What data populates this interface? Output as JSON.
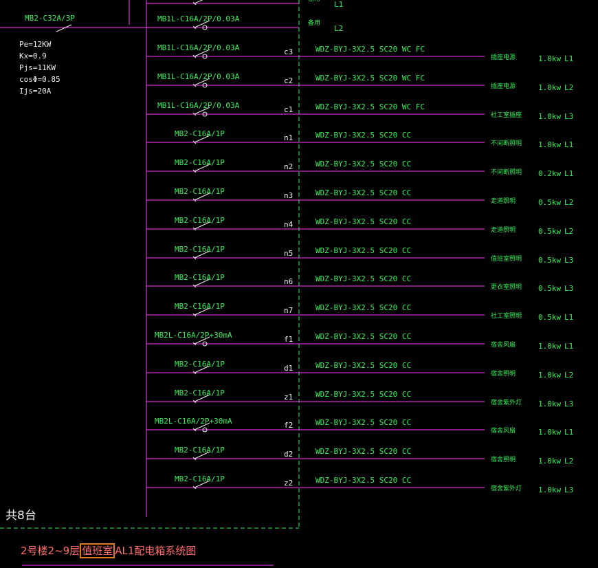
{
  "colors": {
    "bus": "#ff3cff",
    "wire": "#ff3cff",
    "text_green": "#34f05a",
    "text_white": "#f0f0f0",
    "title": "#ff6a6a",
    "highlight": "#e07a1a",
    "boundary": "#34f05a"
  },
  "main_breaker": {
    "label": "MB2-C32A/3P"
  },
  "parameters": [
    "Pe=12KW",
    "Kx=0.9",
    "Pjs=11KW",
    "cosΦ=0.85",
    "Ijs=20A"
  ],
  "corner_label": "共8台",
  "title": {
    "prefix": "2号楼2~9层",
    "highlight": "值班室",
    "suffix": "AL1配电箱系统图"
  },
  "circuits": [
    {
      "breaker": "",
      "code": "",
      "cable": "",
      "use": "备用",
      "power": "",
      "phase": "L1",
      "device": "switch"
    },
    {
      "breaker": "MB1L-C16A/2P/0.03A",
      "code": "",
      "cable": "",
      "use": "备用",
      "power": "",
      "phase": "L2",
      "device": "rcd"
    },
    {
      "breaker": "MB1L-C16A/2P/0.03A",
      "code": "c3",
      "cable": "WDZ-BYJ-3X2.5 SC20 WC FC",
      "use": "插座电源",
      "power": "1.0kw",
      "phase": "L1",
      "device": "rcd"
    },
    {
      "breaker": "MB1L-C16A/2P/0.03A",
      "code": "c2",
      "cable": "WDZ-BYJ-3X2.5 SC20 WC FC",
      "use": "插座电源",
      "power": "1.0kw",
      "phase": "L2",
      "device": "rcd"
    },
    {
      "breaker": "MB1L-C16A/2P/0.03A",
      "code": "c1",
      "cable": "WDZ-BYJ-3X2.5 SC20 WC FC",
      "use": "社工室插座",
      "power": "1.0kw",
      "phase": "L3",
      "device": "rcd"
    },
    {
      "breaker": "MB2-C16A/1P",
      "code": "n1",
      "cable": "WDZ-BYJ-3X2.5 SC20 CC",
      "use": "不间断照明",
      "power": "1.0kw",
      "phase": "L1",
      "device": "switch"
    },
    {
      "breaker": "MB2-C16A/1P",
      "code": "n2",
      "cable": "WDZ-BYJ-3X2.5 SC20 CC",
      "use": "不间断照明",
      "power": "0.2kw",
      "phase": "L1",
      "device": "switch"
    },
    {
      "breaker": "MB2-C16A/1P",
      "code": "n3",
      "cable": "WDZ-BYJ-3X2.5 SC20 CC",
      "use": "走道照明",
      "power": "0.5kw",
      "phase": "L2",
      "device": "switch"
    },
    {
      "breaker": "MB2-C16A/1P",
      "code": "n4",
      "cable": "WDZ-BYJ-3X2.5 SC20 CC",
      "use": "走道照明",
      "power": "0.5kw",
      "phase": "L2",
      "device": "switch"
    },
    {
      "breaker": "MB2-C16A/1P",
      "code": "n5",
      "cable": "WDZ-BYJ-3X2.5 SC20 CC",
      "use": "值班室照明",
      "power": "0.5kw",
      "phase": "L3",
      "device": "switch"
    },
    {
      "breaker": "MB2-C16A/1P",
      "code": "n6",
      "cable": "WDZ-BYJ-3X2.5 SC20 CC",
      "use": "更衣室照明",
      "power": "0.5kw",
      "phase": "L3",
      "device": "switch"
    },
    {
      "breaker": "MB2-C16A/1P",
      "code": "n7",
      "cable": "WDZ-BYJ-3X2.5 SC20 CC",
      "use": "社工室照明",
      "power": "0.5kw",
      "phase": "L1",
      "device": "switch"
    },
    {
      "breaker": "MB2L-C16A/2P+30mA",
      "code": "f1",
      "cable": "WDZ-BYJ-3X2.5 SC20 CC",
      "use": "宿舍风扇",
      "power": "1.0kw",
      "phase": "L1",
      "device": "rcd"
    },
    {
      "breaker": "MB2-C16A/1P",
      "code": "d1",
      "cable": "WDZ-BYJ-3X2.5 SC20 CC",
      "use": "宿舍照明",
      "power": "1.0kw",
      "phase": "L2",
      "device": "switch"
    },
    {
      "breaker": "MB2-C16A/1P",
      "code": "z1",
      "cable": "WDZ-BYJ-3X2.5 SC20 CC",
      "use": "宿舍紫外灯",
      "power": "1.0kw",
      "phase": "L3",
      "device": "switch"
    },
    {
      "breaker": "MB2L-C16A/2P+30mA",
      "code": "f2",
      "cable": "WDZ-BYJ-3X2.5 SC20 CC",
      "use": "宿舍风扇",
      "power": "1.0kw",
      "phase": "L1",
      "device": "rcd"
    },
    {
      "breaker": "MB2-C16A/1P",
      "code": "d2",
      "cable": "WDZ-BYJ-3X2.5 SC20 CC",
      "use": "宿舍照明",
      "power": "1.0kw",
      "phase": "L2",
      "device": "switch"
    },
    {
      "breaker": "MB2-C16A/1P",
      "code": "z2",
      "cable": "WDZ-BYJ-3X2.5 SC20 CC",
      "use": "宿舍紫外灯",
      "power": "1.0kw",
      "phase": "L3",
      "device": "switch"
    }
  ]
}
